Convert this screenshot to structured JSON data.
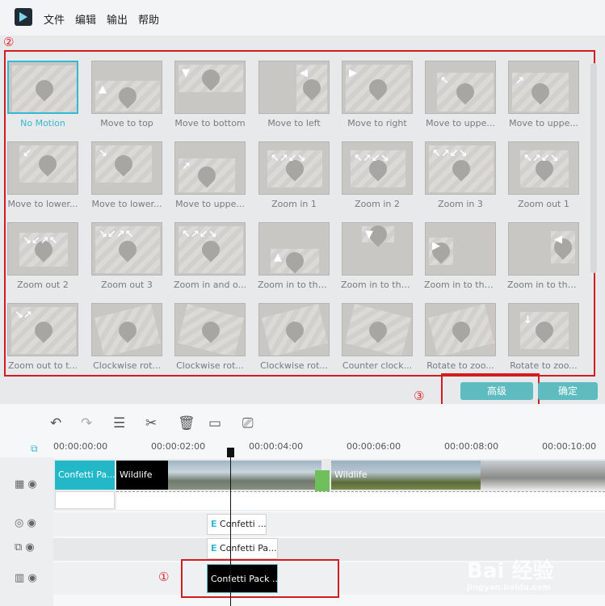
{
  "menu": [
    "文件",
    "编辑",
    "输出",
    "帮助"
  ],
  "annotations": [
    "①",
    "②",
    "③"
  ],
  "motions": [
    [
      "No Motion",
      "Move to top",
      "Move to bottom",
      "Move to left",
      "Move to right",
      "Move to uppe...",
      "Move to uppe..."
    ],
    [
      "Move to lower...",
      "Move to lower...",
      "Move to uppe...",
      "Zoom in 1",
      "Zoom in 2",
      "Zoom in 3",
      "Zoom out 1"
    ],
    [
      "Zoom out 2",
      "Zoom out 3",
      "Zoom in and o...",
      "Zoom in to the...",
      "Zoom in to the...",
      "Zoom in to the...",
      "Zoom in to the..."
    ],
    [
      "Zoom out to t...",
      "Clockwise rot...",
      "Clockwise rot...",
      "Clockwise rot...",
      "Counter clock...",
      "Rotate to zoo...",
      "Rotate to zoo..."
    ]
  ],
  "buttons": {
    "advanced": "高级",
    "ok": "确定"
  },
  "timeline": {
    "ticks": [
      "00:00:00:00",
      "00:00:02:00",
      "00:00:04:00",
      "00:00:06:00",
      "00:00:08:00",
      "00:00:10:00"
    ],
    "clips": {
      "confetti1": "Confetti Pa...",
      "wildlife1": "Wildlife",
      "wildlife2": "Wildlife",
      "text1": "Confetti ...",
      "text2": "Confetti Pa...",
      "confetti_pack": "Confetti Pack ..."
    }
  },
  "watermark": {
    "line1": "Bai 经验",
    "line2": "jingyan.baidu.com"
  },
  "colors": {
    "accent": "#35b9d3",
    "button": "#5ebcc0",
    "annotation": "#d11d22"
  }
}
